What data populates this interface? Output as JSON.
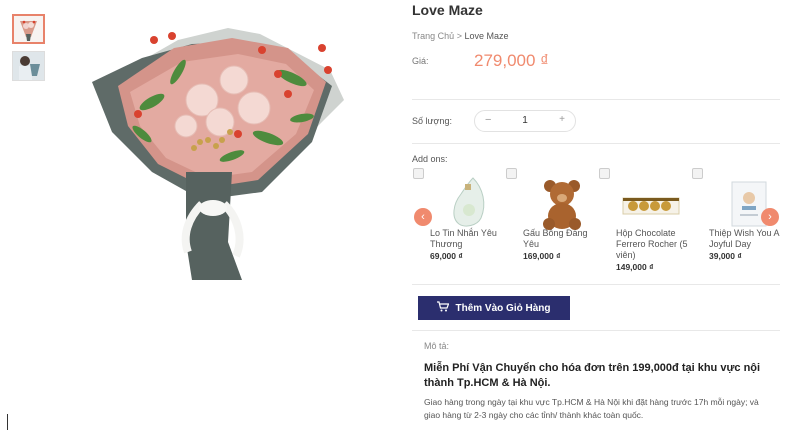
{
  "product": {
    "title": "Love Maze",
    "breadcrumb": {
      "home": "Trang Chủ",
      "sep": ">",
      "current": "Love Maze"
    },
    "price_label": "Giá:",
    "price": "279,000 ₫"
  },
  "quantity": {
    "label": "Số lượng:",
    "minus": "−",
    "value": "1",
    "plus": "+"
  },
  "addons": {
    "label": "Add ons:",
    "items": [
      {
        "name": "Lo Tin Nhắn Yêu Thương",
        "price": "69,000 ₫"
      },
      {
        "name": "Gấu Bông Đáng Yêu",
        "price": "169,000 ₫"
      },
      {
        "name": "Hộp Chocolate Ferrero Rocher (5 viên)",
        "price": "149,000 ₫"
      },
      {
        "name": "Thiệp Wish You A Joyful Day",
        "price": "39,000 ₫"
      }
    ],
    "prev_icon": "chevron-left-icon",
    "next_icon": "chevron-right-icon"
  },
  "cart_button": {
    "label": "Thêm Vào Giỏ Hàng",
    "icon": "cart-icon"
  },
  "description": {
    "label": "Mô tả:",
    "headline": "Miễn Phí Vận Chuyển cho hóa đơn trên 199,000đ tại khu vực nội thành Tp.HCM & Hà Nội.",
    "body": "Giao hàng trong ngày tại khu vực Tp.HCM & Hà Nội khi đặt hàng trước 17h mỗi ngày; và giao hàng từ 2-3 ngày cho các tỉnh/ thành khác toàn quốc."
  },
  "colors": {
    "accent": "#f08a6e",
    "button": "#2b2e6e"
  }
}
